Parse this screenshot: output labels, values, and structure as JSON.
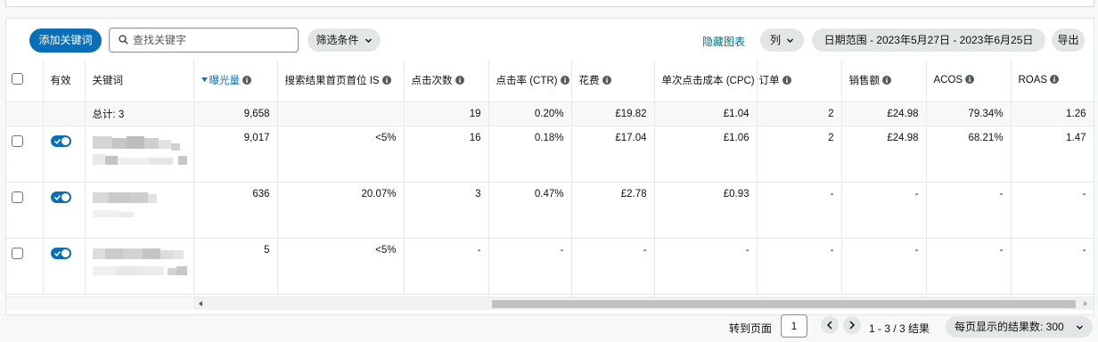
{
  "toolbar": {
    "add_keyword": "添加关键词",
    "search_placeholder": "查找关键字",
    "filter": "筛选条件",
    "hide_chart": "隐藏图表",
    "columns": "列",
    "date_range": "日期范围 - 2023年5月27日 - 2023年6月25日",
    "export": "导出"
  },
  "table": {
    "headers": {
      "active": "有效",
      "keyword": "关键词",
      "impressions": "曝光量",
      "top_of_search_is": "搜索结果首页首位 IS",
      "clicks": "点击次数",
      "ctr": "点击率 (CTR)",
      "spend": "花费",
      "cpc": "单次点击成本 (CPC)",
      "orders": "订单",
      "sales": "销售额",
      "acos": "ACOS",
      "roas": "ROAS"
    },
    "sorted_column": "impressions",
    "total": {
      "label": "总计: 3",
      "impressions": "9,658",
      "top_of_search_is": "",
      "clicks": "19",
      "ctr": "0.20%",
      "spend": "£19.82",
      "cpc": "£1.04",
      "orders": "2",
      "sales": "£24.98",
      "acos": "79.34%",
      "roas": "1.26"
    },
    "rows": [
      {
        "active": true,
        "impressions": "9,017",
        "top_of_search_is": "<5%",
        "clicks": "16",
        "ctr": "0.18%",
        "spend": "£17.04",
        "cpc": "£1.06",
        "orders": "2",
        "sales": "£24.98",
        "acos": "68.21%",
        "roas": "1.47"
      },
      {
        "active": true,
        "impressions": "636",
        "top_of_search_is": "20.07%",
        "clicks": "3",
        "ctr": "0.47%",
        "spend": "£2.78",
        "cpc": "£0.93",
        "orders": "-",
        "sales": "-",
        "acos": "-",
        "roas": "-"
      },
      {
        "active": true,
        "impressions": "5",
        "top_of_search_is": "<5%",
        "clicks": "-",
        "ctr": "-",
        "spend": "-",
        "cpc": "-",
        "orders": "-",
        "sales": "-",
        "acos": "-",
        "roas": "-"
      }
    ]
  },
  "pagination": {
    "goto_label": "转到页面",
    "current_page": "1",
    "results": "1 - 3 / 3 结果",
    "per_page": "每页显示的结果数: 300"
  },
  "colors": {
    "primary": "#0a6fb8",
    "link": "#007185",
    "pill_bg": "#e3e6e6"
  }
}
